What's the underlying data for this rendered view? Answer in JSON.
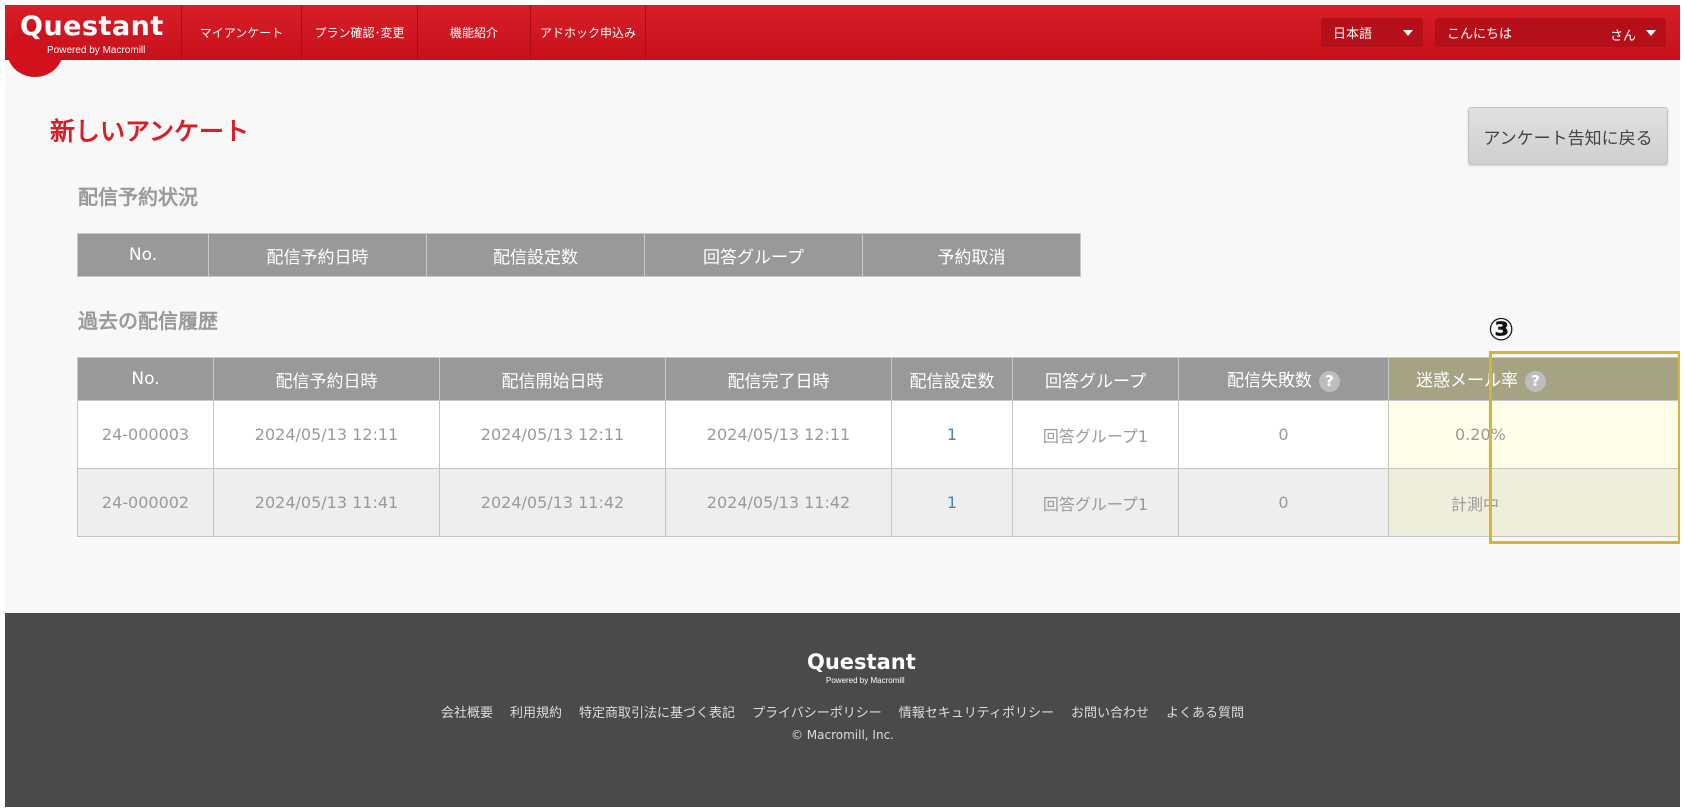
{
  "header": {
    "logo_main": "Questant",
    "logo_sub": "Powered by Macromill",
    "nav": [
      {
        "label": "マイアンケート"
      },
      {
        "label": "プラン確認･変更"
      },
      {
        "label": "機能紹介"
      },
      {
        "label": "アドホック申込み"
      }
    ],
    "language": "日本語",
    "greeting": "こんにちは",
    "user_suffix": "さん"
  },
  "page": {
    "title": "新しいアンケート",
    "back_button": "アンケート告知に戻る"
  },
  "scheduled": {
    "title": "配信予約状況",
    "columns": [
      "No.",
      "配信予約日時",
      "配信設定数",
      "回答グループ",
      "予約取消"
    ]
  },
  "history": {
    "title": "過去の配信履歴",
    "columns": [
      "No.",
      "配信予約日時",
      "配信開始日時",
      "配信完了日時",
      "配信設定数",
      "回答グループ",
      "配信失敗数",
      "迷惑メール率"
    ],
    "help_symbol": "?",
    "rows": [
      {
        "no": "24-000003",
        "scheduled": "2024/05/13 12:11",
        "started": "2024/05/13 12:11",
        "completed": "2024/05/13 12:11",
        "count": "1",
        "group": "回答グループ1",
        "failed": "0",
        "spam_rate": "0.20%"
      },
      {
        "no": "24-000002",
        "scheduled": "2024/05/13 11:41",
        "started": "2024/05/13 11:42",
        "completed": "2024/05/13 11:42",
        "count": "1",
        "group": "回答グループ1",
        "failed": "0",
        "spam_rate": "計測中"
      }
    ]
  },
  "annotation": {
    "marker": "③",
    "color": "#d6b43a"
  },
  "footer": {
    "logo_main": "Questant",
    "logo_sub": "Powered by Macromill",
    "links": [
      "会社概要",
      "利用規約",
      "特定商取引法に基づく表記",
      "プライバシーポリシー",
      "情報セキュリティポリシー",
      "お問い合わせ",
      "よくある質問"
    ],
    "copyright": "© Macromill, Inc."
  }
}
